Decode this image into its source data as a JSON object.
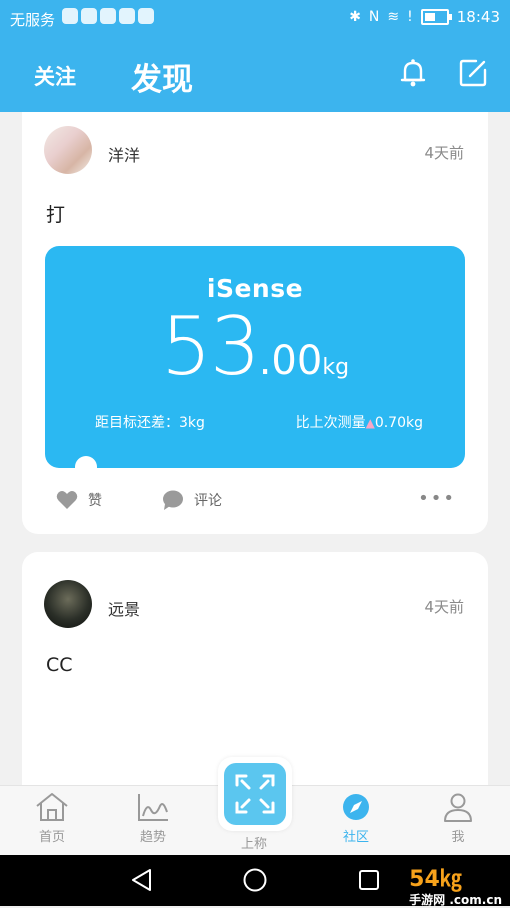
{
  "status_bar": {
    "carrier": "无服务",
    "time": "18:43",
    "icons": [
      "bluetooth-icon",
      "nfc-icon",
      "wifi-icon",
      "alert-icon",
      "battery-icon"
    ]
  },
  "header": {
    "tab_follow": "关注",
    "tab_discover": "发现",
    "icons": [
      "bell-icon",
      "edit-icon"
    ],
    "background": "#3cb4ee"
  },
  "feed": [
    {
      "username": "洋洋",
      "time_ago": "4天前",
      "text": "打",
      "measurement": {
        "brand": "iSense",
        "weight_int": "53",
        "weight_dec": ".00",
        "unit": "kg",
        "goal_label": "距目标还差：3kg",
        "diff_label": "比上次测量",
        "diff_value": "0.70kg"
      },
      "actions": {
        "like": "赞",
        "comment": "评论",
        "more": "•••"
      }
    },
    {
      "username": "远景",
      "time_ago": "4天前",
      "text": "CC"
    }
  ],
  "bottom_nav": {
    "items": [
      "首页",
      "趋势",
      "上称",
      "社区",
      "我"
    ],
    "active": "社区",
    "active_color": "#3cb4ee"
  },
  "watermark": {
    "main": "54㎏",
    "sub": "手游网 .com.cn"
  }
}
